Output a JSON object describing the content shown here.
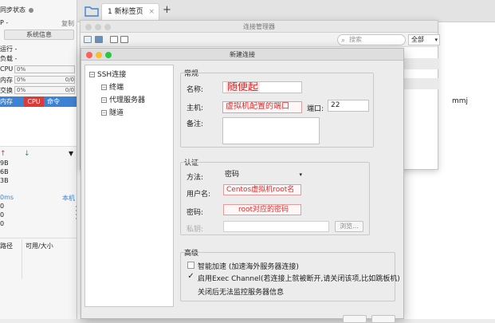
{
  "sidebar": {
    "sync_status": "同步状态",
    "ip_label": "P -",
    "copy_label": "复制",
    "sysinfo_button": "系统信息",
    "uptime": "运行 -",
    "load": "负载 -",
    "metrics": [
      {
        "label": "CPU",
        "bar": "0%",
        "right": ""
      },
      {
        "label": "内存",
        "bar": "0%",
        "right": "0/0"
      },
      {
        "label": "交换",
        "bar": "0%",
        "right": "0/0"
      }
    ],
    "process_tabs": {
      "mem": "内存",
      "cpu": "CPU",
      "cmd": "命令"
    },
    "net_up_icon": "arrow-up-icon",
    "net_down_icon": "arrow-down-icon",
    "net_values": [
      "9B",
      "6B",
      "3B"
    ],
    "latency_label": "0ms",
    "host_label": "本机",
    "latency_values": [
      "0",
      "0",
      "0"
    ],
    "disk_headers": {
      "path": "路径",
      "avail": "可用/大小"
    }
  },
  "tabstrip": {
    "tab_label": "1 新标签页",
    "close": "×",
    "add": "+"
  },
  "connection_manager": {
    "title": "连接管理器",
    "search_placeholder": "搜索",
    "search_icon": "search-icon",
    "filter_value": "全部",
    "row_value": "mmj"
  },
  "new_connection": {
    "title": "新建连接",
    "tree": {
      "root": "SSH连接",
      "children": [
        "终端",
        "代理服务器",
        "隧道"
      ]
    },
    "general": {
      "group_title": "常规",
      "name_label": "名称:",
      "name_value": "随便起",
      "host_label": "主机:",
      "host_value": "虚拟机配置的端口",
      "port_label": "端口:",
      "port_value": "22",
      "notes_label": "备注:"
    },
    "auth": {
      "group_title": "认证",
      "method_label": "方法:",
      "method_value": "密码",
      "user_label": "用户名:",
      "user_value": "Centos虚拟机root名",
      "password_label": "密码:",
      "password_value": "root对应的密码",
      "key_label": "私钥:",
      "browse_button": "浏览..."
    },
    "advanced": {
      "group_title": "高级",
      "smart_accel": "智能加速 (加速海外服务器连接)",
      "smart_accel_checked": false,
      "exec_channel": "启用Exec Channel(若连接上就被断开,请关闭该项,比如跳板机)",
      "exec_channel_checked": true,
      "exec_channel_note": "关闭后无法监控服务器信息"
    }
  },
  "colors": {
    "accent_blue": "#3e83d3",
    "cpu_red": "#d93a3a",
    "annotation_red": "#e12a2a",
    "close_red": "#fe5f57",
    "min_yellow": "#febc2e",
    "max_green": "#28c840"
  }
}
